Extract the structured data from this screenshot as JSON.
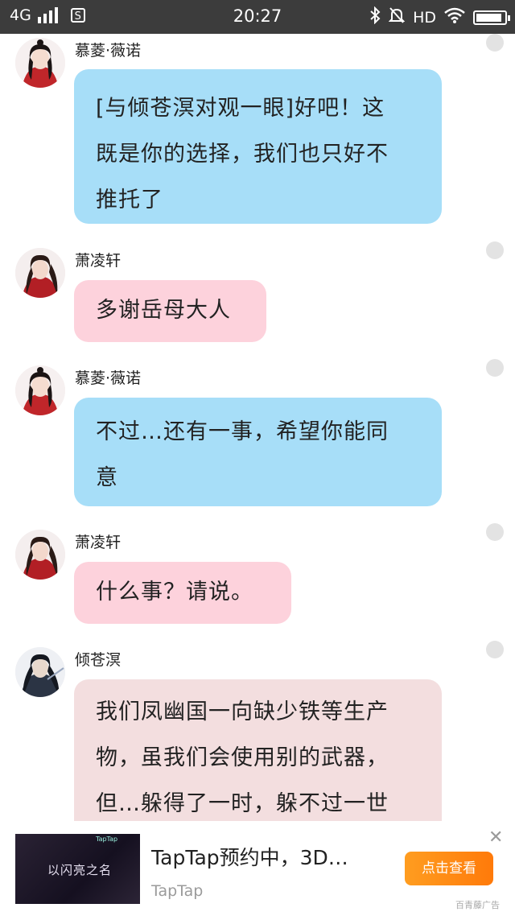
{
  "status_bar": {
    "network": "4G",
    "app_badge": "S",
    "time": "20:27",
    "hd_label": "HD",
    "battery_level": 0.9,
    "icons": [
      "signal-icon",
      "app-notification-icon",
      "bluetooth-icon",
      "mute-icon",
      "wifi-icon",
      "battery-icon"
    ]
  },
  "messages": [
    {
      "sender": "慕菱·薇诺",
      "text": "[与倾苍溟对观一眼]好吧！这既是你的选择，我们也只好不推托了",
      "lines": [
        "[与倾苍溟对观一眼]好吧！这",
        "既是你的选择，我们也只好不",
        "推托了"
      ],
      "color": "#a7def8"
    },
    {
      "sender": "萧凌轩",
      "text": "多谢岳母大人",
      "lines": [
        "多谢岳母大人"
      ],
      "color": "#fdd2dc"
    },
    {
      "sender": "慕菱·薇诺",
      "text": "不过…还有一事，希望你能同意",
      "lines": [
        "不过…还有一事，希望你能同",
        "意"
      ],
      "color": "#a7def8"
    },
    {
      "sender": "萧凌轩",
      "text": "什么事？请说。",
      "lines": [
        "什么事？请说。"
      ],
      "color": "#fdd2dc"
    },
    {
      "sender": "倾苍溟",
      "text": "我们凤幽国一向缺少铁等生产物，虽我们会使用别的武器，但…躲得了一时，躲不过一世",
      "lines": [
        "我们凤幽国一向缺少铁等生产",
        "物，虽我们会使用别的武器，",
        "但…躲得了一时，躲不过一世"
      ],
      "color": "#f3dedf"
    }
  ],
  "ad": {
    "title": "TapTap预约中，3D…",
    "source": "TapTap",
    "button": "点击查看",
    "close": "✕",
    "tag": "百青藤广告",
    "thumb_top_text": "TapTap",
    "thumb_logo_text": "以闪亮之名"
  }
}
